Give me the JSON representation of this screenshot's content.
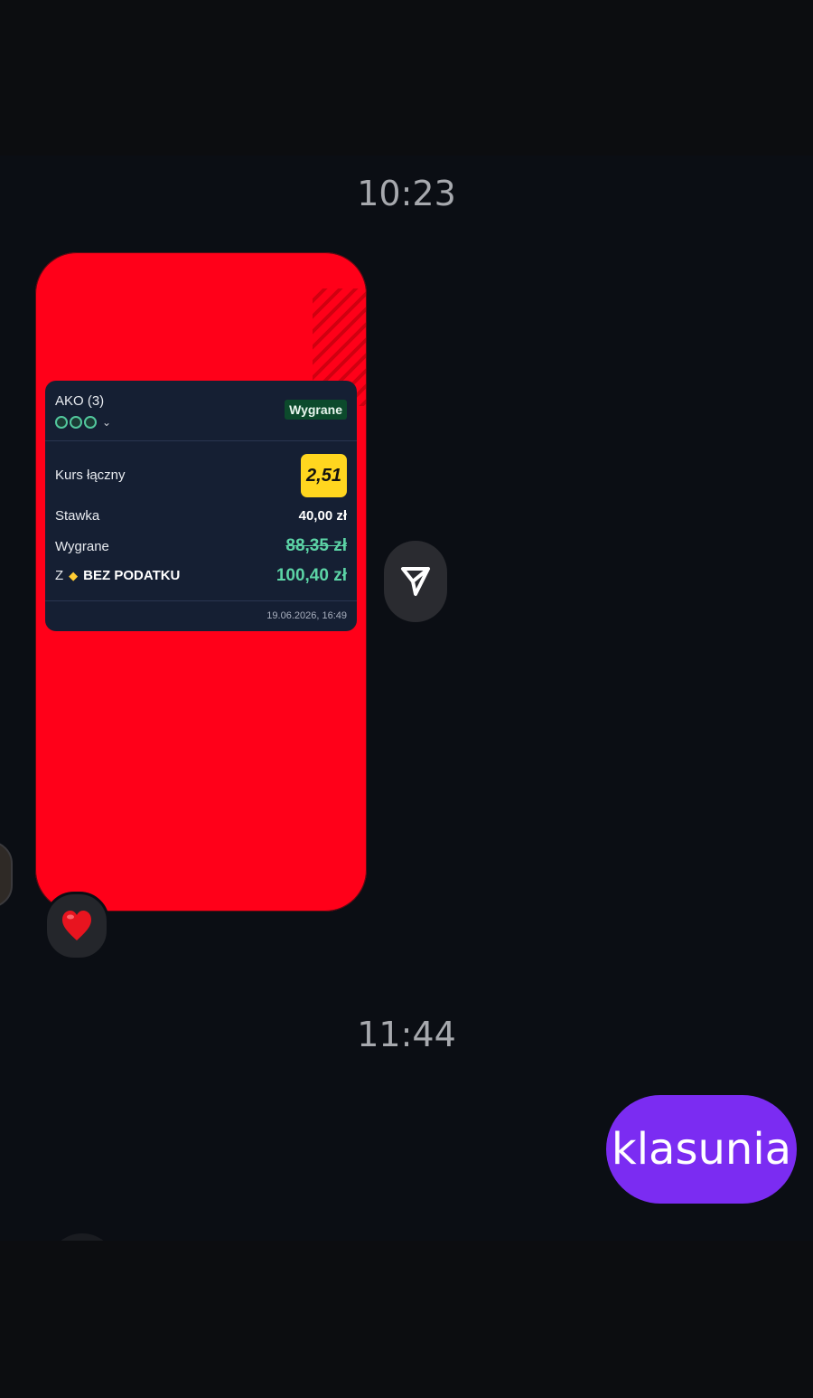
{
  "chat": {
    "timestamp_1": "10:23",
    "timestamp_2": "11:44",
    "sent_message": "klasunia",
    "reaction": "heart"
  },
  "bet_card": {
    "bet_type": "AKO (3)",
    "status": "Wygrane",
    "total_odds_label": "Kurs łączny",
    "total_odds": "2,51",
    "stake_label": "Stawka",
    "stake": "40,00 zł",
    "winnings_label": "Wygrane",
    "winnings_before_tax": "88,35 zł",
    "tax_free_prefix": "Z",
    "tax_free_label": "BEZ PODATKU",
    "winnings_tax_free": "100,40 zł",
    "date": "19.06.2026, 16:49",
    "legs_count": 3
  },
  "colors": {
    "background": "#0b0e14",
    "image_bg": "#ff0019",
    "card_bg": "#151f33",
    "odds_badge": "#ffd61f",
    "win_green": "#5cd4a6",
    "sent_bubble": "#7b2cf2"
  },
  "icons": {
    "forward": "send-forward-icon",
    "reaction": "red-heart-icon",
    "leg_status": "won-leg-icon",
    "expand": "chevron-down-icon"
  }
}
